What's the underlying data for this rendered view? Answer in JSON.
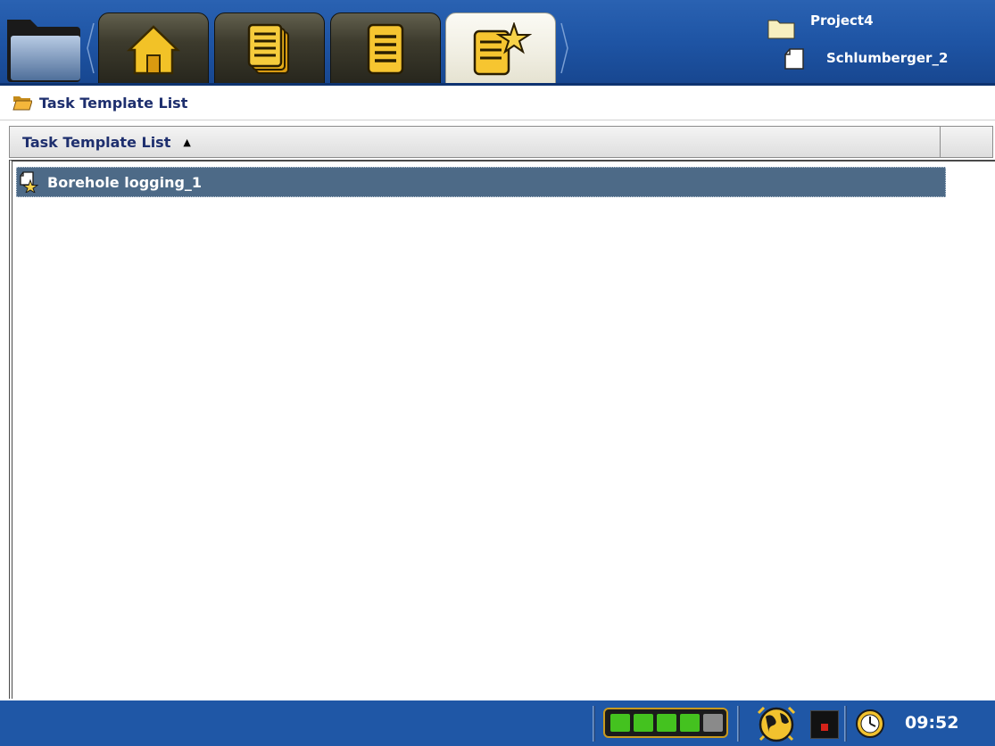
{
  "header": {
    "project_name": "Project4",
    "document_name": "Schlumberger_2"
  },
  "tabs": [
    {
      "name": "home",
      "icon": "home-icon",
      "active": false
    },
    {
      "name": "documents",
      "icon": "document-stack-icon",
      "active": false
    },
    {
      "name": "document",
      "icon": "document-icon",
      "active": false
    },
    {
      "name": "task-templates",
      "icon": "template-star-icon",
      "active": true
    }
  ],
  "breadcrumb": {
    "label": "Task Template List"
  },
  "table": {
    "column_header": "Task Template List",
    "sort_indicator": "▲",
    "rows": [
      {
        "label": "Borehole logging_1",
        "selected": true
      }
    ]
  },
  "status": {
    "battery_cells_filled": 4,
    "battery_cells_total": 5,
    "time": "09:52"
  },
  "colors": {
    "topbar": "#1e54a4",
    "statusbar": "#1f57a6",
    "selection": "#4d6a87",
    "heading_text": "#1e2f6e",
    "battery_green": "#44c21f",
    "battery_gold": "#c89a1f"
  }
}
